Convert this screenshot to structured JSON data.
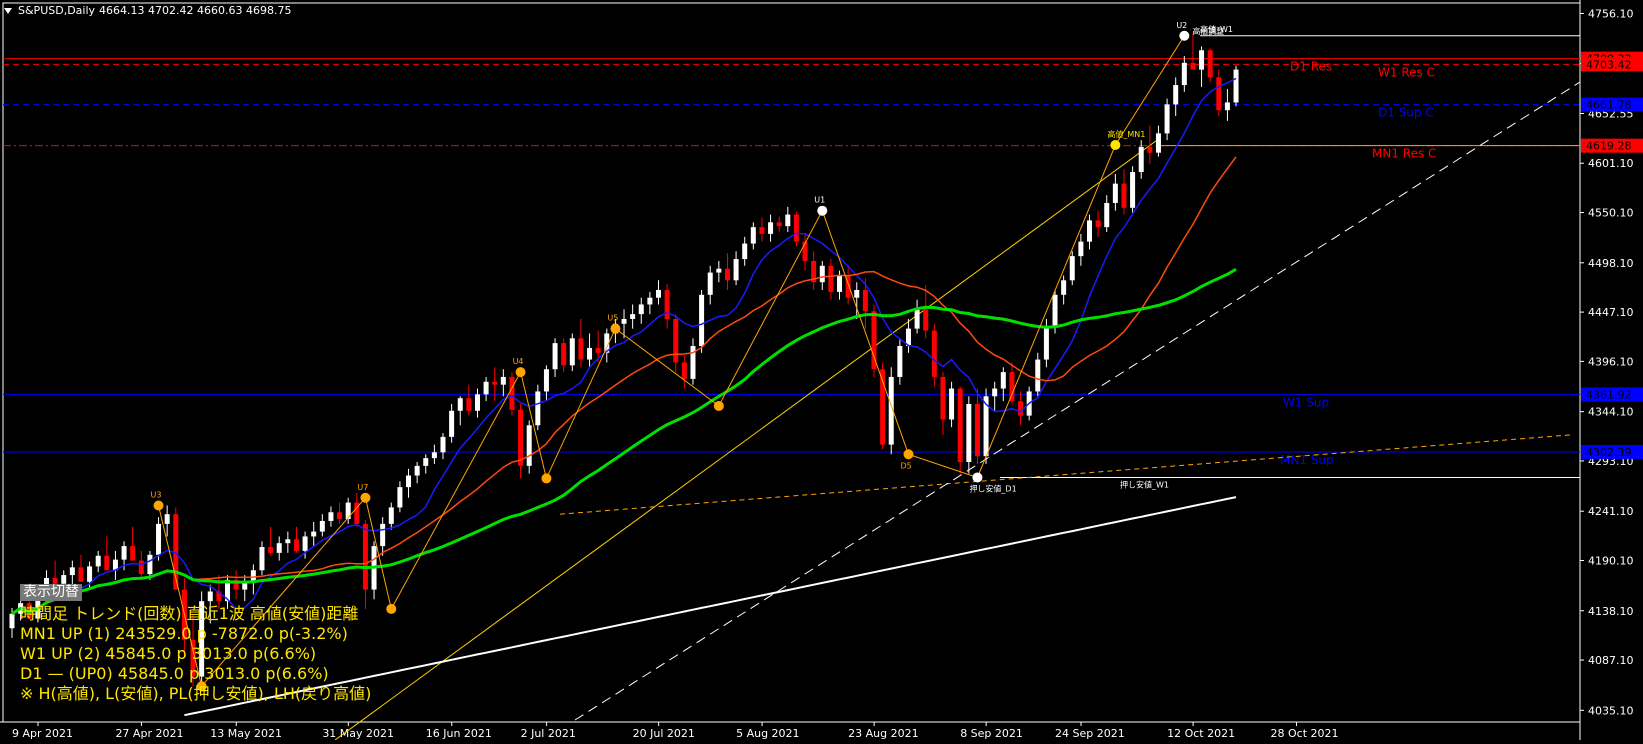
{
  "header": {
    "symbol": "S&PUSD,Daily",
    "ohlc": "4664.13 4702.42 4660.63 4698.75"
  },
  "colors": {
    "background": "#000000",
    "bull": "#ffffff",
    "bear": "#ff0000",
    "ma_fast": "#1a1aff",
    "ma_mid": "#ff4a10",
    "ma_slow": "#00e000",
    "ma_long": "#ffffff",
    "resistance": "#ff0000",
    "support": "#0000ff",
    "mn1_res": "#ffa500",
    "info_text": "#ffe600"
  },
  "chart_data": {
    "type": "candlestick",
    "x_ticks": [
      "9 Apr 2021",
      "27 Apr 2021",
      "13 May 2021",
      "31 May 2021",
      "16 Jun 2021",
      "2 Jul 2021",
      "20 Jul 2021",
      "5 Aug 2021",
      "23 Aug 2021",
      "8 Sep 2021",
      "24 Sep 2021",
      "12 Oct 2021",
      "28 Oct 2021"
    ],
    "y_ticks": [
      "4756.10",
      "4704.33",
      "4652.55",
      "4601.10",
      "4550.10",
      "4498.10",
      "4447.10",
      "4396.10",
      "4344.10",
      "4293.10",
      "4241.10",
      "4190.10",
      "4138.10",
      "4087.10",
      "4035.10"
    ],
    "ylim": [
      4023,
      4770
    ],
    "levels": [
      {
        "price": 4709.32,
        "price_label": "4709.32",
        "label": "D1 Res",
        "color": "#ff0000",
        "style": "solid"
      },
      {
        "price": 4703.42,
        "price_label": "4703.42",
        "label": "W1 Res C",
        "color": "#ff0000",
        "style": "dash"
      },
      {
        "price": 4661.78,
        "price_label": "4661.78",
        "label": "D1 Sup C",
        "color": "#0000ff",
        "style": "dash"
      },
      {
        "price": 4619.28,
        "price_label": "4619.28",
        "label": "MN1 Res C",
        "color": "#ff0000",
        "style": "dashdot"
      },
      {
        "price": 4361.92,
        "price_label": "4361.92",
        "label": "W1 Sup",
        "color": "#0000ff",
        "style": "solid"
      },
      {
        "price": 4302.39,
        "price_label": "4302.39",
        "label": "MN1 Sup",
        "color": "#0000ff",
        "style": "solid"
      }
    ],
    "candles": [
      [
        4120,
        4141,
        4110,
        4135
      ],
      [
        4135,
        4152,
        4128,
        4146
      ],
      [
        4146,
        4160,
        4135,
        4130
      ],
      [
        4130,
        4158,
        4126,
        4150
      ],
      [
        4150,
        4180,
        4145,
        4172
      ],
      [
        4172,
        4190,
        4160,
        4166
      ],
      [
        4166,
        4180,
        4155,
        4175
      ],
      [
        4175,
        4190,
        4165,
        4183
      ],
      [
        4183,
        4196,
        4170,
        4168
      ],
      [
        4168,
        4189,
        4160,
        4184
      ],
      [
        4184,
        4200,
        4178,
        4195
      ],
      [
        4195,
        4215,
        4183,
        4180
      ],
      [
        4180,
        4200,
        4170,
        4191
      ],
      [
        4191,
        4210,
        4180,
        4205
      ],
      [
        4205,
        4225,
        4195,
        4190
      ],
      [
        4190,
        4200,
        4170,
        4176
      ],
      [
        4176,
        4200,
        4170,
        4196
      ],
      [
        4196,
        4235,
        4190,
        4228
      ],
      [
        4228,
        4247,
        4215,
        4238
      ],
      [
        4238,
        4245,
        4175,
        4160
      ],
      [
        4160,
        4172,
        4090,
        4108
      ],
      [
        4108,
        4135,
        4060,
        4070
      ],
      [
        4070,
        4158,
        4060,
        4148
      ],
      [
        4148,
        4165,
        4125,
        4158
      ],
      [
        4158,
        4175,
        4140,
        4148
      ],
      [
        4148,
        4175,
        4140,
        4170
      ],
      [
        4170,
        4180,
        4150,
        4160
      ],
      [
        4160,
        4175,
        4148,
        4168
      ],
      [
        4168,
        4186,
        4155,
        4180
      ],
      [
        4180,
        4210,
        4175,
        4204
      ],
      [
        4204,
        4225,
        4195,
        4198
      ],
      [
        4198,
        4215,
        4190,
        4208
      ],
      [
        4208,
        4220,
        4198,
        4212
      ],
      [
        4212,
        4225,
        4198,
        4200
      ],
      [
        4200,
        4220,
        4192,
        4215
      ],
      [
        4215,
        4230,
        4205,
        4220
      ],
      [
        4220,
        4238,
        4215,
        4231
      ],
      [
        4231,
        4246,
        4225,
        4240
      ],
      [
        4240,
        4250,
        4228,
        4233
      ],
      [
        4233,
        4255,
        4228,
        4250
      ],
      [
        4250,
        4260,
        4225,
        4228
      ],
      [
        4228,
        4232,
        4140,
        4160
      ],
      [
        4160,
        4210,
        4150,
        4205
      ],
      [
        4205,
        4235,
        4195,
        4228
      ],
      [
        4228,
        4250,
        4222,
        4245
      ],
      [
        4245,
        4272,
        4240,
        4266
      ],
      [
        4266,
        4285,
        4255,
        4278
      ],
      [
        4278,
        4292,
        4270,
        4288
      ],
      [
        4288,
        4300,
        4280,
        4296
      ],
      [
        4296,
        4310,
        4290,
        4302
      ],
      [
        4302,
        4322,
        4295,
        4318
      ],
      [
        4318,
        4352,
        4312,
        4345
      ],
      [
        4345,
        4360,
        4330,
        4358
      ],
      [
        4358,
        4372,
        4340,
        4345
      ],
      [
        4345,
        4368,
        4338,
        4362
      ],
      [
        4362,
        4380,
        4355,
        4375
      ],
      [
        4375,
        4390,
        4355,
        4372
      ],
      [
        4372,
        4388,
        4360,
        4380
      ],
      [
        4380,
        4385,
        4340,
        4346
      ],
      [
        4346,
        4352,
        4275,
        4288
      ],
      [
        4288,
        4335,
        4280,
        4330
      ],
      [
        4330,
        4372,
        4325,
        4365
      ],
      [
        4365,
        4392,
        4355,
        4388
      ],
      [
        4388,
        4420,
        4380,
        4415
      ],
      [
        4415,
        4420,
        4385,
        4392
      ],
      [
        4392,
        4425,
        4386,
        4420
      ],
      [
        4420,
        4440,
        4390,
        4398
      ],
      [
        4398,
        4425,
        4390,
        4410
      ],
      [
        4410,
        4428,
        4395,
        4405
      ],
      [
        4405,
        4430,
        4395,
        4425
      ],
      [
        4425,
        4440,
        4415,
        4435
      ],
      [
        4435,
        4450,
        4420,
        4440
      ],
      [
        4440,
        4455,
        4430,
        4445
      ],
      [
        4445,
        4462,
        4435,
        4455
      ],
      [
        4455,
        4468,
        4445,
        4462
      ],
      [
        4462,
        4480,
        4455,
        4470
      ],
      [
        4470,
        4476,
        4430,
        4440
      ],
      [
        4440,
        4445,
        4385,
        4395
      ],
      [
        4395,
        4402,
        4368,
        4378
      ],
      [
        4378,
        4420,
        4372,
        4412
      ],
      [
        4412,
        4470,
        4405,
        4465
      ],
      [
        4465,
        4495,
        4455,
        4488
      ],
      [
        4488,
        4500,
        4478,
        4492
      ],
      [
        4492,
        4508,
        4470,
        4480
      ],
      [
        4480,
        4510,
        4475,
        4502
      ],
      [
        4502,
        4525,
        4495,
        4518
      ],
      [
        4518,
        4540,
        4512,
        4535
      ],
      [
        4535,
        4545,
        4520,
        4528
      ],
      [
        4528,
        4548,
        4520,
        4540
      ],
      [
        4540,
        4546,
        4530,
        4536
      ],
      [
        4536,
        4556,
        4530,
        4548
      ],
      [
        4548,
        4551,
        4515,
        4520
      ],
      [
        4520,
        4528,
        4490,
        4500
      ],
      [
        4500,
        4510,
        4470,
        4478
      ],
      [
        4478,
        4500,
        4470,
        4495
      ],
      [
        4495,
        4502,
        4460,
        4468
      ],
      [
        4468,
        4490,
        4460,
        4485
      ],
      [
        4485,
        4495,
        4455,
        4462
      ],
      [
        4462,
        4478,
        4440,
        4470
      ],
      [
        4470,
        4482,
        4430,
        4448
      ],
      [
        4448,
        4455,
        4380,
        4388
      ],
      [
        4388,
        4395,
        4305,
        4310
      ],
      [
        4310,
        4390,
        4300,
        4380
      ],
      [
        4380,
        4420,
        4372,
        4412
      ],
      [
        4412,
        4440,
        4405,
        4430
      ],
      [
        4430,
        4460,
        4425,
        4450
      ],
      [
        4450,
        4475,
        4420,
        4428
      ],
      [
        4428,
        4435,
        4370,
        4380
      ],
      [
        4380,
        4385,
        4320,
        4336
      ],
      [
        4336,
        4375,
        4328,
        4368
      ],
      [
        4368,
        4370,
        4280,
        4292
      ],
      [
        4292,
        4360,
        4280,
        4352
      ],
      [
        4352,
        4368,
        4290,
        4298
      ],
      [
        4298,
        4368,
        4290,
        4360
      ],
      [
        4360,
        4375,
        4345,
        4368
      ],
      [
        4368,
        4390,
        4355,
        4385
      ],
      [
        4385,
        4395,
        4352,
        4355
      ],
      [
        4355,
        4365,
        4330,
        4340
      ],
      [
        4340,
        4370,
        4335,
        4365
      ],
      [
        4365,
        4405,
        4360,
        4398
      ],
      [
        4398,
        4440,
        4390,
        4432
      ],
      [
        4432,
        4470,
        4425,
        4465
      ],
      [
        4465,
        4485,
        4455,
        4480
      ],
      [
        4480,
        4510,
        4475,
        4505
      ],
      [
        4505,
        4528,
        4495,
        4520
      ],
      [
        4520,
        4548,
        4512,
        4542
      ],
      [
        4542,
        4552,
        4525,
        4535
      ],
      [
        4535,
        4568,
        4530,
        4560
      ],
      [
        4560,
        4590,
        4552,
        4580
      ],
      [
        4580,
        4595,
        4548,
        4555
      ],
      [
        4555,
        4598,
        4550,
        4592
      ],
      [
        4592,
        4625,
        4585,
        4618
      ],
      [
        4618,
        4640,
        4600,
        4612
      ],
      [
        4612,
        4640,
        4608,
        4632
      ],
      [
        4632,
        4668,
        4625,
        4662
      ],
      [
        4662,
        4690,
        4650,
        4682
      ],
      [
        4682,
        4712,
        4675,
        4705
      ],
      [
        4705,
        4735,
        4698,
        4698
      ],
      [
        4698,
        4722,
        4680,
        4718
      ],
      [
        4718,
        4720,
        4685,
        4690
      ],
      [
        4690,
        4698,
        4650,
        4656
      ],
      [
        4656,
        4678,
        4645,
        4664
      ],
      [
        4664,
        4702,
        4660,
        4698
      ]
    ],
    "swing_points": [
      {
        "type": "high",
        "label": "U3",
        "color": "#ffa500"
      },
      {
        "type": "low",
        "label": "",
        "color": "#ffa500"
      },
      {
        "type": "low",
        "label": "",
        "color": "#ffa500"
      },
      {
        "type": "high",
        "label": "U7",
        "color": "#ffa500"
      },
      {
        "type": "high",
        "label": "U4",
        "color": "#ffa500"
      },
      {
        "type": "low",
        "label": "",
        "color": "#ffa500"
      },
      {
        "type": "high",
        "label": "U5",
        "color": "#ffa500"
      },
      {
        "type": "low",
        "label": "",
        "color": "#ffa500"
      },
      {
        "type": "high",
        "label": "U1",
        "color": "#ffffff"
      },
      {
        "type": "low",
        "label": "D5",
        "color": "#ffa500"
      },
      {
        "type": "low",
        "label": "押し安値_D1",
        "color": "#ffffff"
      },
      {
        "type": "high",
        "label": "高値_MN1",
        "color": "#ffe600"
      },
      {
        "type": "high",
        "label": "U2",
        "color": "#ffffff"
      }
    ],
    "annotations": {
      "w1_high": "高値_W1",
      "w1_low": "押し安値_W1",
      "top_label": "高値調整"
    }
  },
  "info_panel": {
    "toggle_label": "表示切替",
    "header": "時間足 トレンド(回数)  直近1波 高値(安値)距離",
    "rows": [
      "MN1  UP (1)    243529.0 p  -7872.0 p(-3.2%)",
      "W1    UP (2)    45845.0 p  3013.0 p(6.6%)",
      "D1    —   (UP0) 45845.0 p  3013.0 p(6.6%)"
    ],
    "legend": "※ H(高値), L(安値), PL(押し安値), LH(戻り高値)"
  }
}
